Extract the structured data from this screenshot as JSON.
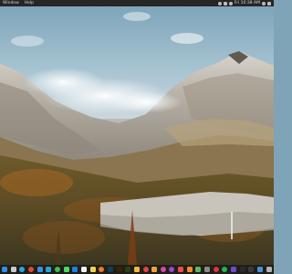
{
  "menubar": {
    "app_menu": "Window",
    "help_menu": "Help",
    "clock": "Fri 10:38 AM"
  },
  "wallpaper": {
    "subject": "alpine mountain valley with autumn forest and clouds"
  },
  "dock": {
    "items": [
      {
        "name": "finder-icon",
        "color": "#2f8ef3"
      },
      {
        "name": "launchpad-icon",
        "color": "#c9c9c9"
      },
      {
        "name": "safari-icon",
        "color": "#2aa4e8"
      },
      {
        "name": "chrome-icon",
        "color": "#e04836"
      },
      {
        "name": "mail-icon",
        "color": "#3c8fe6"
      },
      {
        "name": "telegram-icon",
        "color": "#2aa3dd"
      },
      {
        "name": "whatsapp-icon",
        "color": "#3bbf54"
      },
      {
        "name": "messages-icon",
        "color": "#4cd964"
      },
      {
        "name": "app-store-icon",
        "color": "#1f7fe8"
      },
      {
        "name": "calendar-icon",
        "color": "#f2f2f2"
      },
      {
        "name": "notes-icon",
        "color": "#f3d24b"
      },
      {
        "name": "firefox-icon",
        "color": "#f0772a"
      },
      {
        "name": "photoshop-icon",
        "color": "#123b5c"
      },
      {
        "name": "illustrator-icon",
        "color": "#3a2405"
      },
      {
        "name": "dreamweaver-icon",
        "color": "#2f3f15"
      },
      {
        "name": "sketch-icon",
        "color": "#f4b93d"
      },
      {
        "name": "music-icon",
        "color": "#e8424c"
      },
      {
        "name": "photos-icon",
        "color": "#e9a33d"
      },
      {
        "name": "itunes-icon",
        "color": "#d64aa3"
      },
      {
        "name": "podcasts-icon",
        "color": "#9b44d8"
      },
      {
        "name": "news-icon",
        "color": "#f24a4a"
      },
      {
        "name": "books-icon",
        "color": "#f08c2b"
      },
      {
        "name": "maps-icon",
        "color": "#5fb85f"
      },
      {
        "name": "settings-icon",
        "color": "#8a8a8a"
      },
      {
        "name": "no-entry-icon",
        "color": "#e0353a"
      },
      {
        "name": "spotify-icon",
        "color": "#1db954"
      },
      {
        "name": "vpn-icon",
        "color": "#6b4ad6"
      },
      {
        "name": "terminal-icon",
        "color": "#2a2a2a"
      },
      {
        "name": "activity-monitor-icon",
        "color": "#3a3a3a"
      },
      {
        "name": "downloads-icon",
        "color": "#4a90d9"
      },
      {
        "name": "trash-icon",
        "color": "#b5b5b5"
      }
    ]
  }
}
